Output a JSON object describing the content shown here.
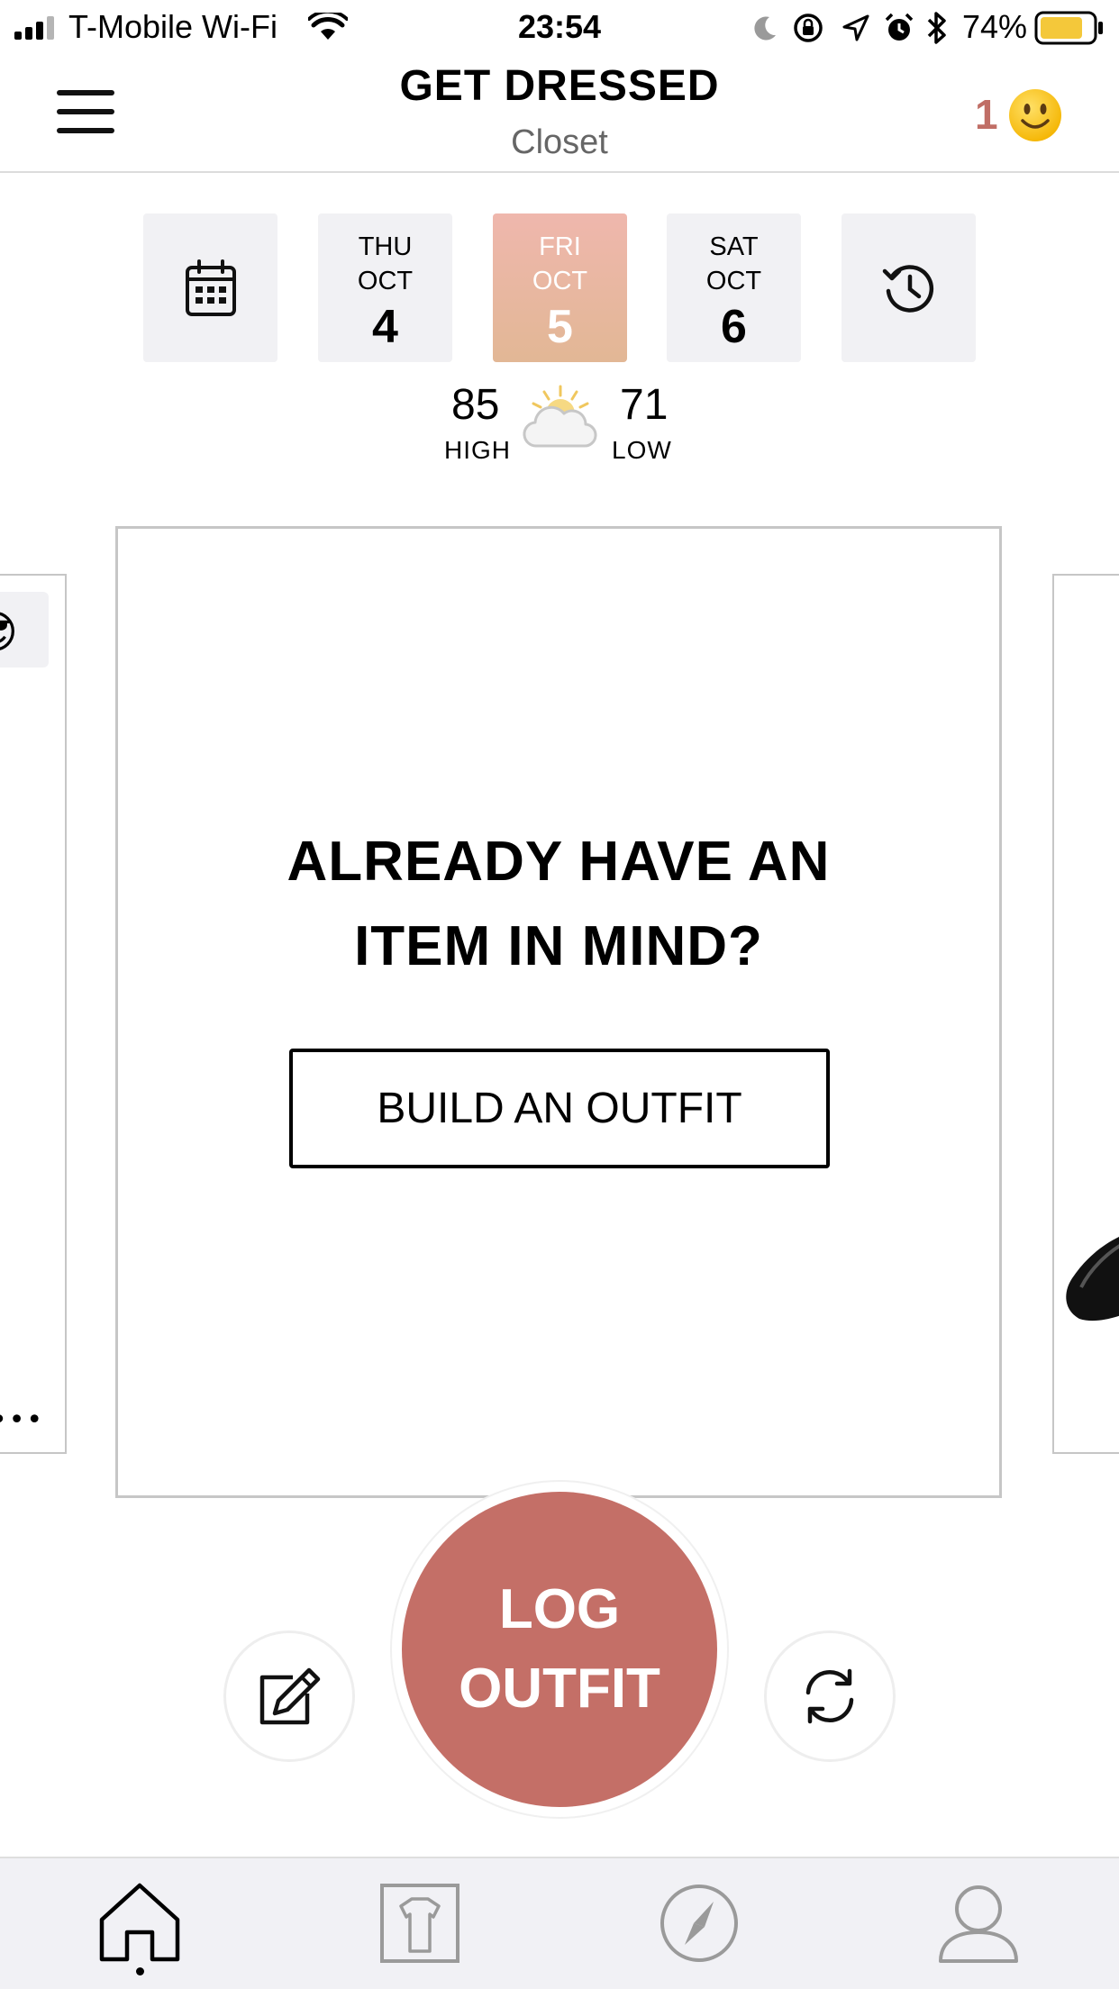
{
  "status_bar": {
    "carrier": "T-Mobile Wi-Fi",
    "time": "23:54",
    "battery_percent": "74%",
    "icons": [
      "signal-icon",
      "wifi-icon",
      "moon-icon",
      "orientation-lock-icon",
      "location-icon",
      "alarm-icon",
      "bluetooth-icon",
      "battery-icon"
    ]
  },
  "header": {
    "title": "GET DRESSED",
    "subtitle": "Closet",
    "notification_count": "1",
    "notification_emoji": "🙂",
    "menu_icon": "hamburger-menu-icon"
  },
  "dates": [
    {
      "dow": "THU",
      "month": "OCT",
      "day": "4",
      "selected": false
    },
    {
      "dow": "FRI",
      "month": "OCT",
      "day": "5",
      "selected": true
    },
    {
      "dow": "SAT",
      "month": "OCT",
      "day": "6",
      "selected": false
    }
  ],
  "weather": {
    "high": "85",
    "high_label": "HIGH",
    "low": "71",
    "low_label": "LOW",
    "icon": "partly-sunny-icon"
  },
  "card": {
    "prompt_line1": "ALREADY HAVE AN",
    "prompt_line2": "ITEM IN MIND?",
    "button_label": "BUILD AN OUTFIT"
  },
  "side_cards": {
    "left_emoji": "😎",
    "left_more": "•••"
  },
  "actions": {
    "log_line1": "LOG",
    "log_line2": "OUTFIT",
    "edit_icon": "edit-icon",
    "refresh_icon": "refresh-icon"
  },
  "tabs": [
    "home-icon",
    "closet-icon",
    "explore-icon",
    "profile-icon"
  ],
  "colors": {
    "accent": "#c46f67",
    "selected_tile_top": "#efb7ad",
    "selected_tile_bottom": "#e2b795",
    "tile_bg": "#f1f1f4",
    "tabbar_bg": "#f1f1f5"
  }
}
